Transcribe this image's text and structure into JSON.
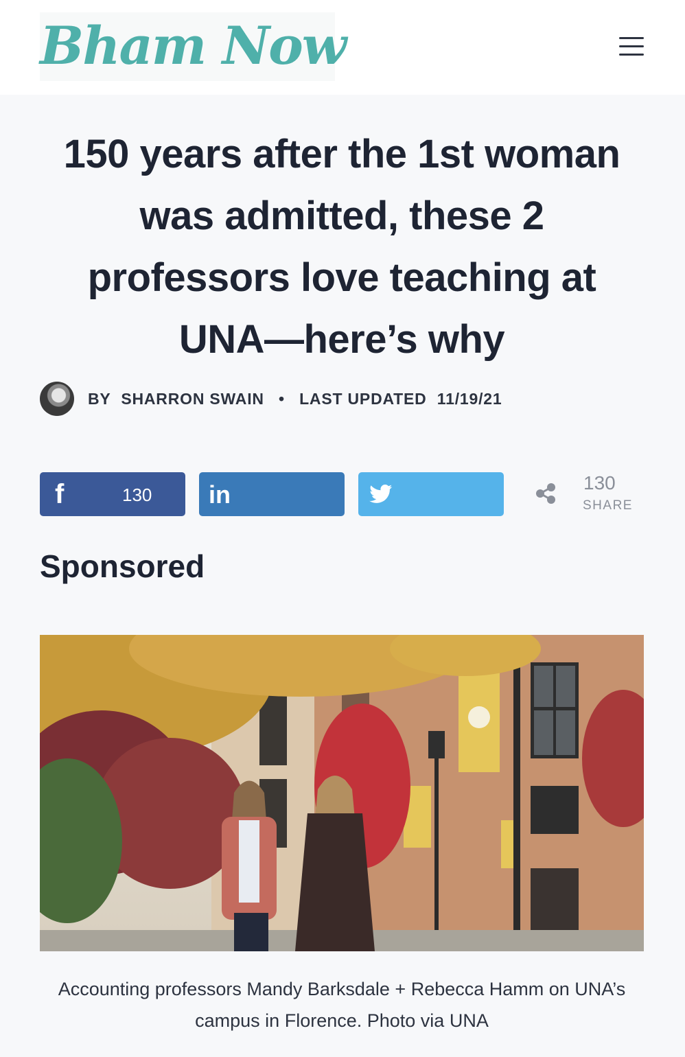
{
  "header": {
    "logo_text": "Bham Now",
    "menu_icon": "hamburger-menu-icon"
  },
  "article": {
    "title": "150 years after the 1st woman was admitted, these 2 professors love teaching at UNA—here’s why",
    "by_label": "BY",
    "author": "SHARRON SWAIN",
    "separator": "•",
    "updated_label": "LAST UPDATED",
    "updated_date": "11/19/21",
    "section_label": "Sponsored",
    "caption": "Accounting professors Mandy Barksdale + Rebecca Hamm on UNA’s campus in Florence. Photo via UNA"
  },
  "share": {
    "facebook_icon": "facebook-icon",
    "facebook_count": "130",
    "linkedin_icon": "linkedin-icon",
    "twitter_icon": "twitter-icon",
    "share_icon": "share-icon",
    "total_count": "130",
    "total_label": "SHARE",
    "colors": {
      "facebook": "#3b5998",
      "linkedin": "#3a7ab8",
      "twitter": "#55b3ea"
    }
  },
  "colors": {
    "logo": "#4fb0aa",
    "title": "#1e2433",
    "background": "#f7f8fa"
  }
}
